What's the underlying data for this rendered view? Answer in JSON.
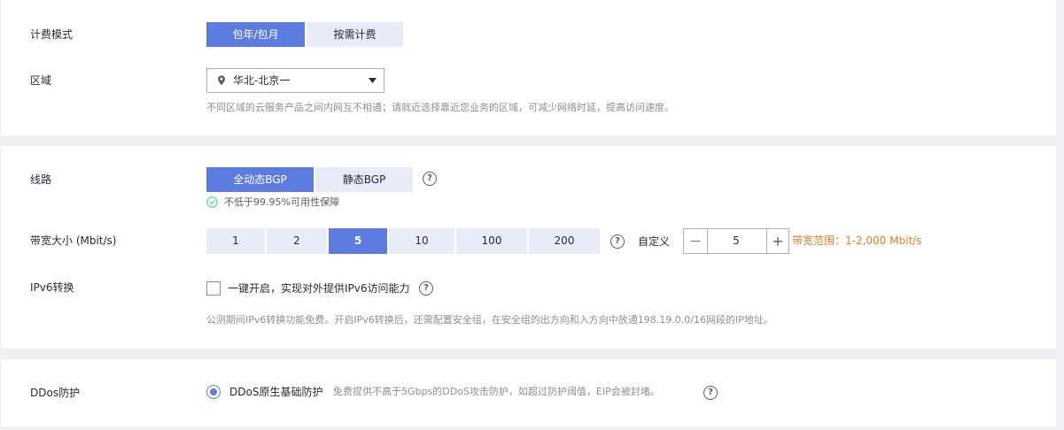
{
  "billing": {
    "label": "计费模式",
    "options": [
      "包年/包月",
      "按需计费"
    ]
  },
  "region": {
    "label": "区域",
    "selected": "华北-北京一",
    "hint": "不同区域的云服务产品之间内网互不相通；请就近选择靠近您业务的区域，可减少网络时延，提高访问速度。"
  },
  "line": {
    "label": "线路",
    "options": [
      "全动态BGP",
      "静态BGP"
    ],
    "guarantee": "不低于99.95%可用性保障"
  },
  "bandwidth": {
    "label": "带宽大小 (Mbit/s)",
    "options": [
      "1",
      "2",
      "5",
      "10",
      "100",
      "200"
    ],
    "custom_label": "自定义",
    "value": "5",
    "minus": "—",
    "plus": "+",
    "range": "带宽范围：1-2,000 Mbit/s"
  },
  "ipv6": {
    "label": "IPv6转换",
    "checkbox_label": "一键开启，实现对外提供IPv6访问能力",
    "hint": "公测期间IPv6转换功能免费。开启IPv6转换后，还需配置安全组，在安全组的出方向和入方向中放通198.19.0.0/16网段的IP地址。"
  },
  "ddos": {
    "label": "DDos防护",
    "option_label": "DDoS原生基础防护",
    "desc": "免费提供不高于5Gbps的DDoS攻击防护，如超过防护阈值，EIP会被封堵。"
  },
  "help_glyph": "?",
  "colors": {
    "accent": "#5e7ce0",
    "range_text": "#e37d29",
    "success": "#50d4ab"
  }
}
